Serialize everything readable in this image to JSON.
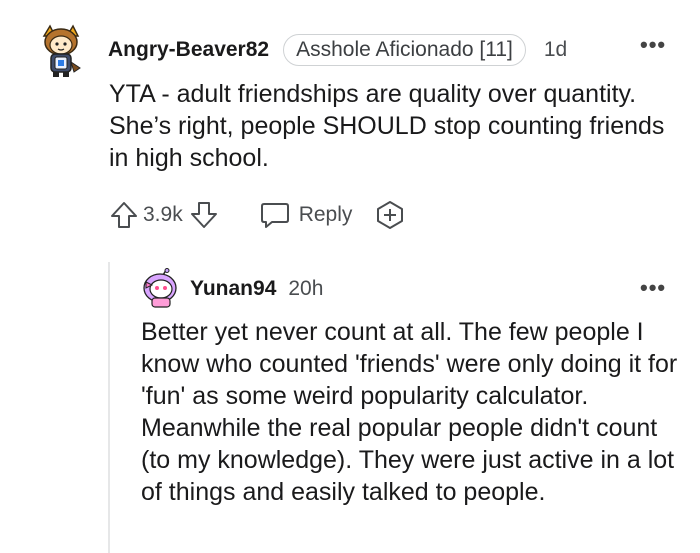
{
  "comment": {
    "username": "Angry-Beaver82",
    "flair": "Asshole Aficionado [11]",
    "timestamp": "1d",
    "more_label": "•••",
    "body": "YTA - adult friendships are quality over quantity. She’s right, people SHOULD stop counting friends in high school.",
    "vote_count": "3.9k",
    "reply_label": "Reply"
  },
  "reply": {
    "username": "Yunan94",
    "timestamp": "20h",
    "more_label": "•••",
    "body": "Better yet never count at all. The few people I know who counted 'friends' were only doing it for 'fun' as some weird popularity calculator. Meanwhile the real popular people didn't count (to my knowledge). They were just active in a lot of things and easily talked to people."
  },
  "icons": {
    "upvote": "upvote-arrow-icon",
    "downvote": "downvote-arrow-icon",
    "reply": "speech-bubble-icon",
    "award": "award-plus-icon",
    "more": "ellipsis-icon"
  },
  "colors": {
    "text": "#1a1a1b",
    "meta": "#4a4d50",
    "flair_border": "#cfd2d4",
    "thread_line": "#e6e7e8"
  }
}
